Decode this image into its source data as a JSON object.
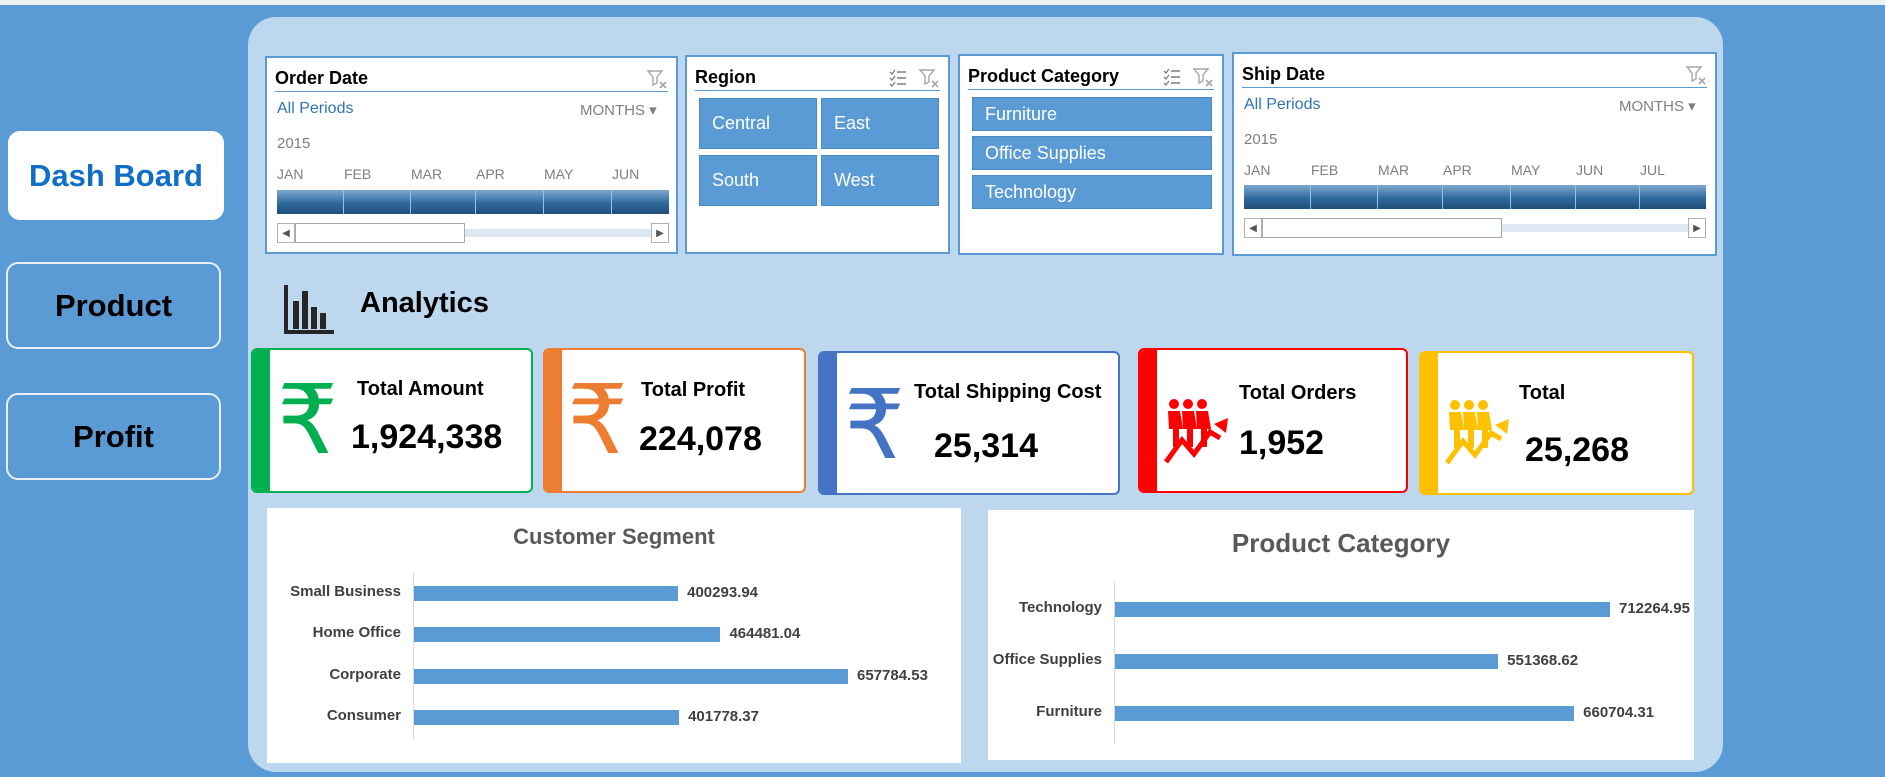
{
  "nav": {
    "dashboard_label": "Dash Board",
    "product_label": "Product",
    "profit_label": "Profit"
  },
  "order_date_slicer": {
    "title": "Order Date",
    "all_periods": "All Periods",
    "level": "MONTHS",
    "year": "2015",
    "months": [
      "JAN",
      "FEB",
      "MAR",
      "APR",
      "MAY",
      "JUN"
    ]
  },
  "region_slicer": {
    "title": "Region",
    "items": [
      "Central",
      "East",
      "South",
      "West"
    ]
  },
  "category_slicer": {
    "title": "Product Category",
    "items": [
      "Furniture",
      "Office Supplies",
      "Technology"
    ]
  },
  "ship_date_slicer": {
    "title": "Ship Date",
    "all_periods": "All Periods",
    "level": "MONTHS",
    "year": "2015",
    "months": [
      "JAN",
      "FEB",
      "MAR",
      "APR",
      "MAY",
      "JUN",
      "JUL"
    ]
  },
  "analytics": {
    "label": "Analytics"
  },
  "kpis": [
    {
      "title": "Total Amount",
      "value": "1,924,338",
      "color": "#00b050",
      "icon": "rupee-icon"
    },
    {
      "title": "Total Profit",
      "value": "224,078",
      "color": "#ed7d31",
      "icon": "rupee-icon"
    },
    {
      "title": "Total Shipping Cost",
      "value": "25,314",
      "color": "#4472c4",
      "icon": "rupee-icon"
    },
    {
      "title": "Total Orders",
      "value": "1,952",
      "color": "#ff0000",
      "icon": "people-growth-icon"
    },
    {
      "title": "Total",
      "value": "25,268",
      "color": "#ffc000",
      "icon": "people-growth-icon"
    }
  ],
  "chart_data": [
    {
      "type": "bar",
      "title": "Customer Segment",
      "categories": [
        "Small Business",
        "Home Office",
        "Corporate",
        "Consumer"
      ],
      "values": [
        400293.94,
        464481.04,
        657784.53,
        401778.37
      ],
      "value_labels": [
        "400293.94",
        "464481.04",
        "657784.53",
        "401778.37"
      ],
      "color": "#5b9bd5"
    },
    {
      "type": "bar",
      "title": "Product Category",
      "categories": [
        "Technology",
        "Office Supplies",
        "Furniture"
      ],
      "values": [
        712264.95,
        551368.62,
        660704.31
      ],
      "value_labels": [
        "712264.95",
        "551368.62",
        "660704.31"
      ],
      "color": "#5b9bd5"
    }
  ]
}
